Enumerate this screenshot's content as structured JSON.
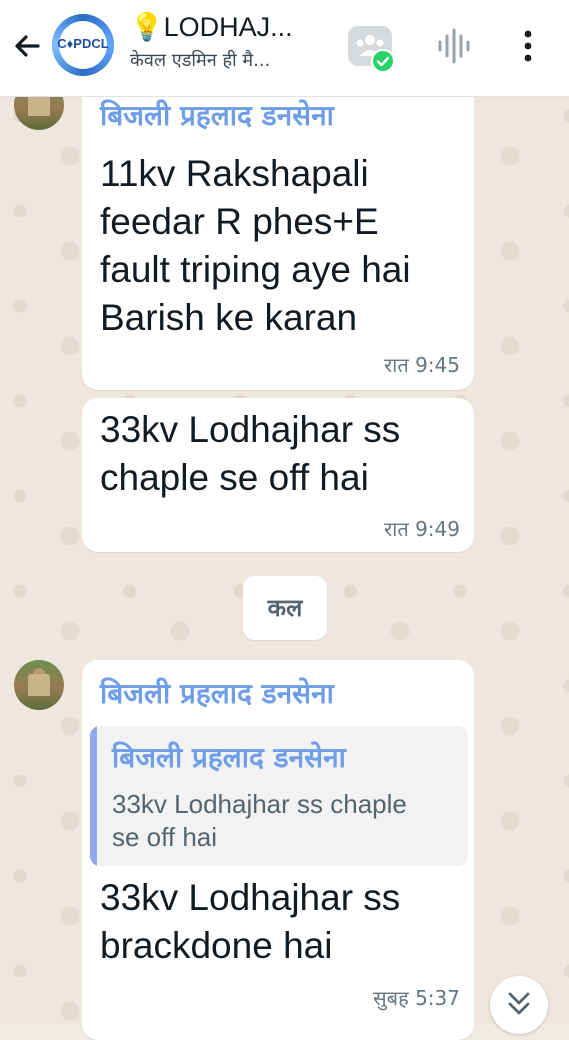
{
  "header": {
    "group_name": "💡LODHAJ...",
    "group_subtitle": "केवल एडमिन ही मै...",
    "avatar_logo_text": "C♦PDCL"
  },
  "messages": [
    {
      "sender": "बिजली प्रहलाद डनसेना",
      "text": "11kv Rakshapali\nfeedar R phes+E\nfault triping aye hai\nBarish ke karan",
      "time": "रात 9:45"
    },
    {
      "text": "33kv Lodhajhar ss\nchaple se off hai",
      "time": "रात 9:49"
    },
    {
      "sender": "बिजली प्रहलाद डनसेना",
      "quoted_sender": "बिजली प्रहलाद डनसेना",
      "quoted_text": "33kv Lodhajhar ss chaple\nse off hai",
      "text": "33kv Lodhajhar ss\nbrackdone hai",
      "time": "सुबह 5:37"
    }
  ],
  "date_divider": "कल",
  "colors": {
    "sender_name": "#6f9ee8",
    "quote_bar": "#8fa8f0",
    "community_badge": "#25d366"
  },
  "icons": [
    "back-arrow-icon",
    "community-icon",
    "check-badge-icon",
    "voice-wave-icon",
    "more-vert-icon",
    "chevron-double-down-icon"
  ]
}
